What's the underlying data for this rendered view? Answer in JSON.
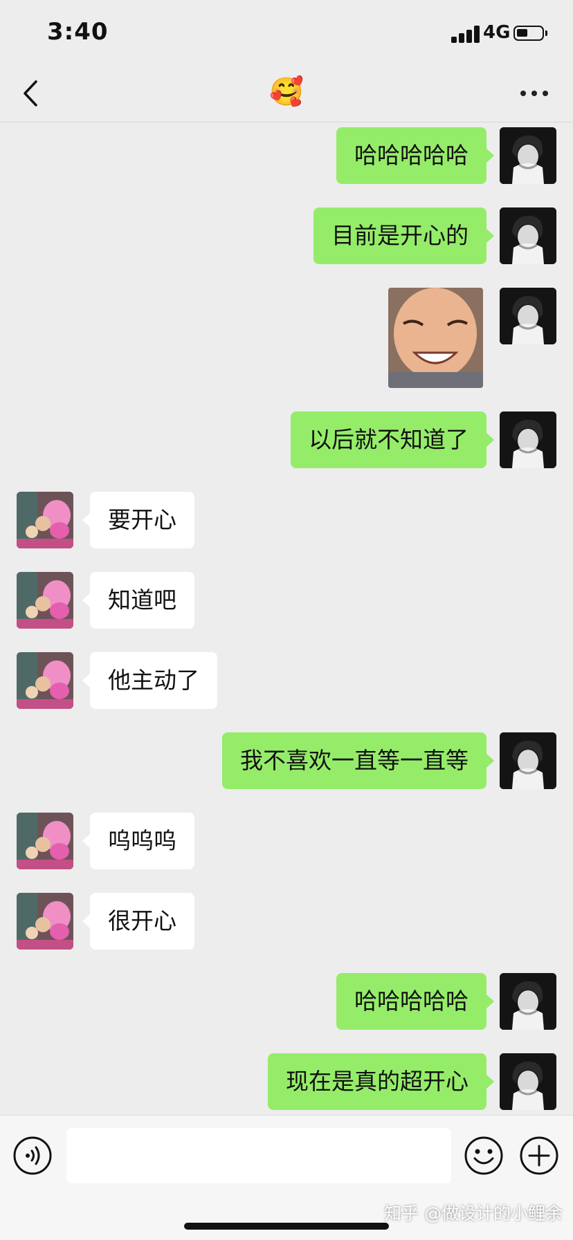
{
  "status_bar": {
    "time": "3:40",
    "network": "4G"
  },
  "header": {
    "title": "🥰"
  },
  "colors": {
    "my_bubble": "#95ec69",
    "their_bubble": "#ffffff",
    "background": "#ededed"
  },
  "messages": [
    {
      "from": "me",
      "type": "text",
      "text": "哈哈哈哈哈"
    },
    {
      "from": "me",
      "type": "text",
      "text": "目前是开心的"
    },
    {
      "from": "me",
      "type": "sticker",
      "sticker": "laughing-baby-sticker"
    },
    {
      "from": "me",
      "type": "text",
      "text": "以后就不知道了"
    },
    {
      "from": "other",
      "type": "text",
      "text": "要开心"
    },
    {
      "from": "other",
      "type": "text",
      "text": "知道吧"
    },
    {
      "from": "other",
      "type": "text",
      "text": "他主动了"
    },
    {
      "from": "me",
      "type": "text",
      "text": "我不喜欢一直等一直等"
    },
    {
      "from": "other",
      "type": "text",
      "text": "呜呜呜"
    },
    {
      "from": "other",
      "type": "text",
      "text": "很开心"
    },
    {
      "from": "me",
      "type": "text",
      "text": "哈哈哈哈哈"
    },
    {
      "from": "me",
      "type": "text",
      "text": "现在是真的超开心"
    }
  ],
  "input_bar": {
    "value": "",
    "watermark": "知乎 @做设计的小鲤余"
  }
}
